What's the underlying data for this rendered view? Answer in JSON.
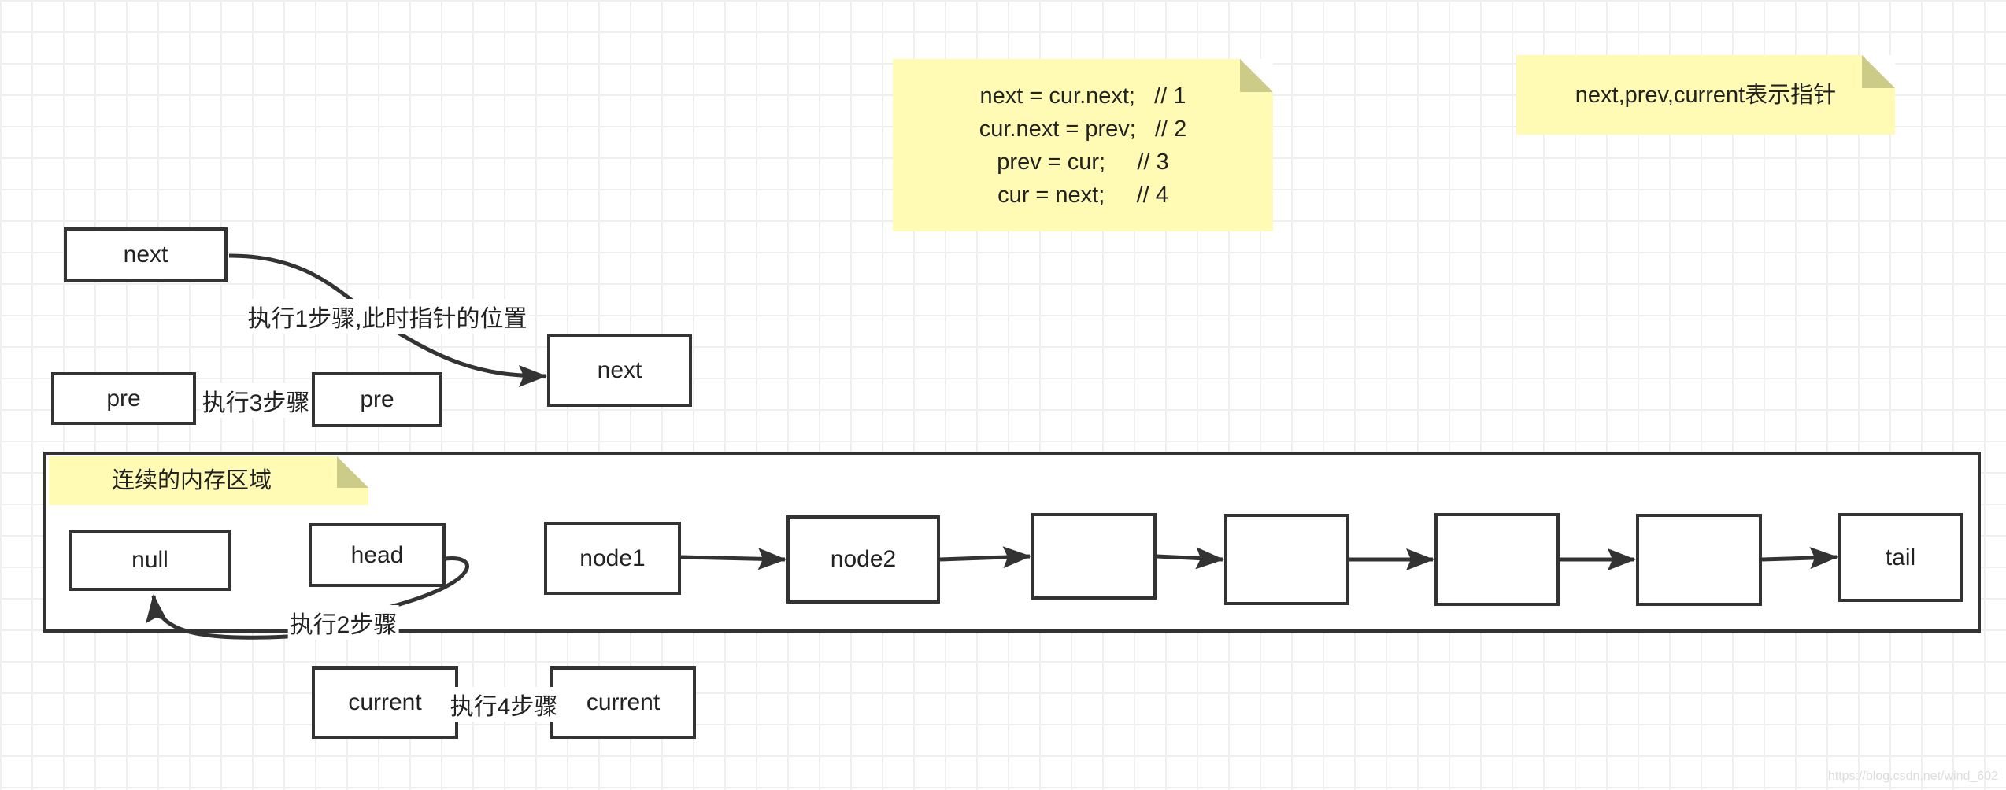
{
  "notes": {
    "code": [
      "next = cur.next;   // 1",
      "cur.next = prev;   // 2",
      "prev = cur;     // 3",
      "cur = next;     // 4"
    ],
    "legend": "next,prev,current表示指针",
    "memory": "连续的内存区域"
  },
  "boxes": {
    "next_before": "next",
    "next_after": "next",
    "pre_before": "pre",
    "pre_after": "pre",
    "null": "null",
    "head": "head",
    "node1": "node1",
    "node2": "node2",
    "empty1": "",
    "empty2": "",
    "empty3": "",
    "empty4": "",
    "tail": "tail",
    "current_before": "current",
    "current_after": "current"
  },
  "steps": {
    "s1": "执行1步骤,此时指针的位置",
    "s2": "执行2步骤",
    "s3": "执行3步骤",
    "s4": "执行4步骤"
  },
  "watermark": "https://blog.csdn.net/wind_602",
  "colors": {
    "note": "#fffbb4",
    "note_fold": "#cccc88",
    "stroke": "#333333"
  }
}
